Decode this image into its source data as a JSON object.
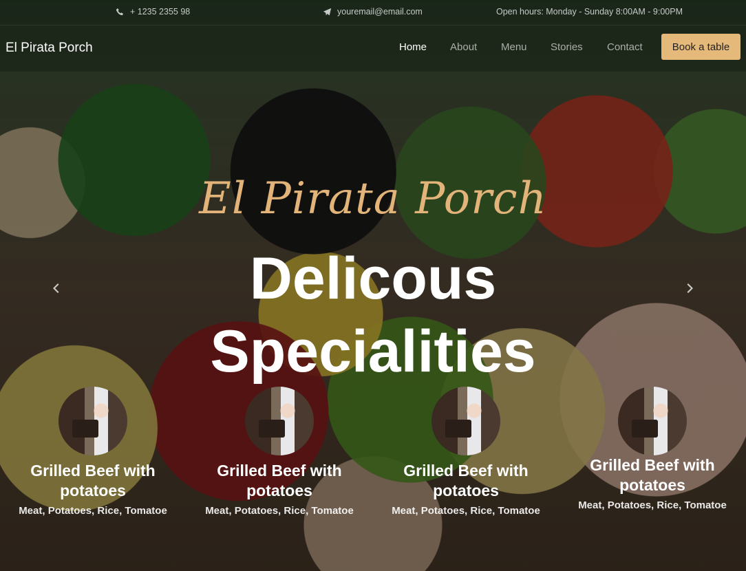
{
  "topbar": {
    "phone": "+ 1235 2355 98",
    "email": "youremail@email.com",
    "hours": "Open hours: Monday - Sunday 8:00AM - 9:00PM"
  },
  "navbar": {
    "brand": "El Pirata Porch",
    "links": [
      "Home",
      "About",
      "Menu",
      "Stories",
      "Contact"
    ],
    "active": "Home",
    "cta": "Book a table"
  },
  "hero": {
    "script_title": "El Pirata Porch",
    "headline_line1": "Delicous",
    "headline_line2": "Specialities",
    "prev_label": "Previous",
    "next_label": "Next"
  },
  "cards": [
    {
      "title": "Grilled Beef with potatoes",
      "subtitle": "Meat, Potatoes, Rice, Tomatoe"
    },
    {
      "title": "Grilled Beef with potatoes",
      "subtitle": "Meat, Potatoes, Rice, Tomatoe"
    },
    {
      "title": "Grilled Beef with potatoes",
      "subtitle": "Meat, Potatoes, Rice, Tomatoe"
    },
    {
      "title": "Grilled Beef with potatoes",
      "subtitle": "Meat, Potatoes, Rice, Tomatoe"
    }
  ],
  "colors": {
    "accent": "#e5b97a",
    "script": "#e3b47a"
  },
  "icons": [
    "phone-icon",
    "paper-plane-icon",
    "chevron-left-icon",
    "chevron-right-icon"
  ]
}
